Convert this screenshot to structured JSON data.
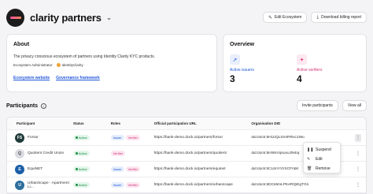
{
  "header": {
    "title": "clarity partners",
    "edit_label": "Edit Ecosystem",
    "download_label": "Download billing report"
  },
  "about": {
    "title": "About",
    "description": "The privacy conscious ecosystem of partners using Identity Clarity KYC products.",
    "admin_label": "Ecosystem Administrator",
    "admin_name": "IdentityClarity",
    "website_link": "Ecosystem website",
    "governance_link": "Governance framework"
  },
  "overview": {
    "title": "Overview",
    "issuers_label": "Active issuers",
    "issuers_value": "3",
    "verifiers_label": "Active verifiers",
    "verifiers_value": "4"
  },
  "participants": {
    "title": "Participants",
    "invite_label": "Invite participants",
    "view_all_label": "View all",
    "columns": [
      "Participant",
      "Status",
      "Roles",
      "Official participation URL",
      "Organisation DID"
    ],
    "rows": [
      {
        "name": "Forsur",
        "initials": "FS",
        "color": "#1f3b3a",
        "status": "Active",
        "roles": [
          "Issuer",
          "Verifier"
        ],
        "url": "https://bank-demo.dock.io/partners/forsur",
        "did": "did:dock:5HLbQLSmrRRxc1Wu"
      },
      {
        "name": "Quotient Credit Union",
        "initials": "Q",
        "color": "#d9dbe0",
        "status": "Active",
        "roles": [
          "Verifier"
        ],
        "url": "https://bank-demo.dock.io/partners/quotient",
        "did": "did:dock:5HWsVqsuxuJ9vbq"
      },
      {
        "name": "EquiNET",
        "initials": "E",
        "color": "#1c5fa8",
        "status": "Active",
        "roles": [
          "Issuer",
          "Verifier"
        ],
        "url": "https://bank-demo.dock.io/partners/equinet",
        "did": "did:dock:5CL6nYVzXCFnbK"
      },
      {
        "name": "UrbanScape - Apartment Li...",
        "initials": "U",
        "color": "#2e6f9e",
        "status": "Active",
        "roles": [
          "Issuer",
          "Verifier"
        ],
        "url": "https://bank-demo.dock.io/partners/urbanscape",
        "did": "did:dock:5DCk6mLPKeRQiEgTGs"
      }
    ]
  },
  "menu": {
    "items": [
      {
        "label": "Suspend",
        "icon": "pause-icon"
      },
      {
        "label": "Edit",
        "icon": "pencil-icon"
      },
      {
        "label": "Remove",
        "icon": "trash-icon"
      }
    ]
  }
}
